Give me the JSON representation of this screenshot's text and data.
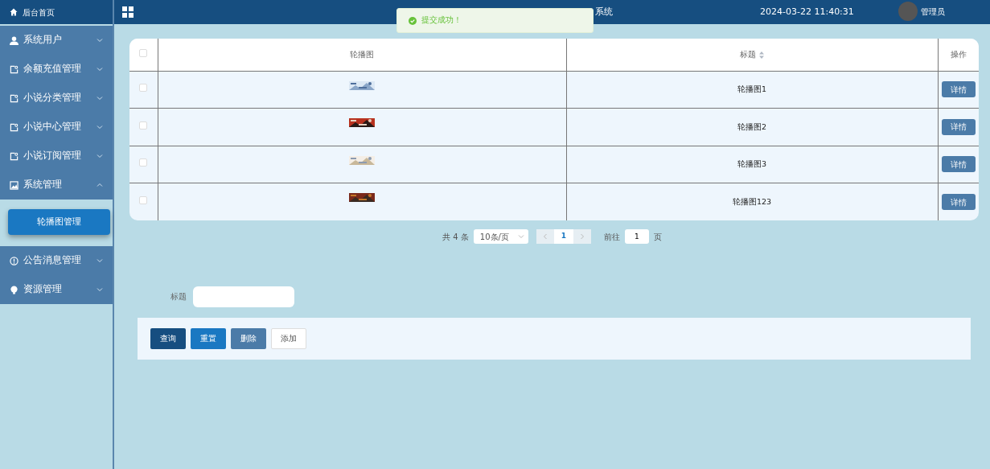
{
  "header": {
    "title_visible": "系统",
    "datetime": "2024-03-22 11:40:31",
    "user": "管理员"
  },
  "toast": {
    "message": "提交成功！"
  },
  "sidebar": {
    "home": "后台首页",
    "items": [
      {
        "label": "系统用户",
        "expanded": false
      },
      {
        "label": "余额充值管理",
        "expanded": false
      },
      {
        "label": "小说分类管理",
        "expanded": false
      },
      {
        "label": "小说中心管理",
        "expanded": false
      },
      {
        "label": "小说订阅管理",
        "expanded": false
      },
      {
        "label": "系统管理",
        "expanded": true,
        "children": [
          {
            "label": "轮播图管理",
            "selected": true
          }
        ]
      },
      {
        "label": "公告消息管理",
        "expanded": false
      },
      {
        "label": "资源管理",
        "expanded": false
      }
    ]
  },
  "table": {
    "select_all_checked": false,
    "columns": [
      "轮播图",
      "标题",
      "操作"
    ],
    "rows": [
      {
        "title": "轮播图1",
        "checked": false,
        "action": "详情"
      },
      {
        "title": "轮播图2",
        "checked": false,
        "action": "详情"
      },
      {
        "title": "轮播图3",
        "checked": false,
        "action": "详情"
      },
      {
        "title": "轮播图123",
        "checked": false,
        "action": "详情"
      }
    ]
  },
  "pagination": {
    "total": "共 4 条",
    "page_size": "10条/页",
    "current_page": "1",
    "goto_label": "前往",
    "goto_value": "1",
    "goto_suffix": "页"
  },
  "search": {
    "label": "标题"
  },
  "buttons": [
    {
      "label": "查询",
      "kind": "dark"
    },
    {
      "label": "重置",
      "kind": "primary"
    },
    {
      "label": "删除",
      "kind": "muted"
    },
    {
      "label": "添加",
      "kind": "plain"
    }
  ]
}
